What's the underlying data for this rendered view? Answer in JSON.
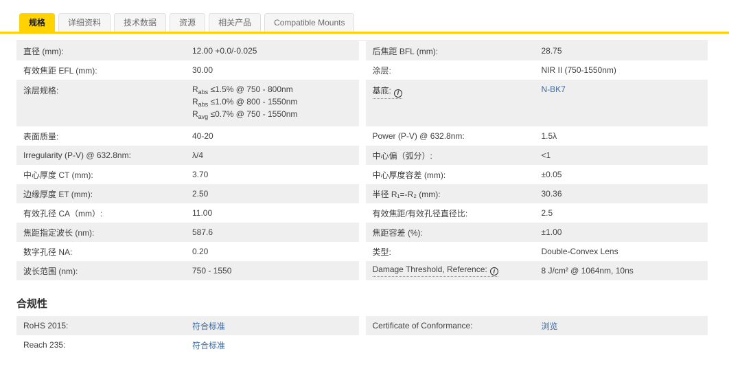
{
  "tabs": {
    "items": [
      {
        "label": "规格",
        "active": true
      },
      {
        "label": "详细资料",
        "active": false
      },
      {
        "label": "技术数据",
        "active": false
      },
      {
        "label": "资源",
        "active": false
      },
      {
        "label": "相关产品",
        "active": false
      },
      {
        "label": "Compatible Mounts",
        "active": false
      }
    ]
  },
  "colors": {
    "accent_yellow": "#FFD200",
    "link_blue": "#3A68A0",
    "row_stripe": "#EFEFEF",
    "text": "#3F3F3E"
  },
  "spec_table": {
    "rows": [
      {
        "left": {
          "label": "直径 (mm):",
          "value": "12.00 +0.0/-0.025"
        },
        "right": {
          "label": "后焦距 BFL (mm):",
          "value": "28.75"
        }
      },
      {
        "left": {
          "label": "有效焦距 EFL (mm):",
          "value": "30.00"
        },
        "right": {
          "label": "涂层:",
          "value": "NIR II (750-1550nm)"
        }
      },
      {
        "left": {
          "label": "涂层规格:",
          "value_lines": [
            {
              "base": "R",
              "sub": "abs",
              "rest": " ≤1.5% @ 750 - 800nm"
            },
            {
              "base": "R",
              "sub": "abs",
              "rest": " ≤1.0% @ 800 - 1550nm"
            },
            {
              "base": "R",
              "sub": "avg",
              "rest": " ≤0.7% @ 750 - 1550nm"
            }
          ]
        },
        "right": {
          "label": "基底:",
          "has_info": true,
          "value": "N-BK7",
          "is_link": true
        }
      },
      {
        "left": {
          "label": "表面质量:",
          "value": "40-20"
        },
        "right": {
          "label": "Power (P-V) @ 632.8nm:",
          "value": "1.5λ"
        }
      },
      {
        "left": {
          "label": "Irregularity (P-V) @ 632.8nm:",
          "value": "λ/4"
        },
        "right": {
          "label": "中心偏（弧分）:",
          "value": "<1"
        }
      },
      {
        "left": {
          "label": "中心厚度 CT (mm):",
          "value": "3.70"
        },
        "right": {
          "label": "中心厚度容差 (mm):",
          "value": "±0.05"
        }
      },
      {
        "left": {
          "label": "边缘厚度 ET (mm):",
          "value": "2.50"
        },
        "right": {
          "label": "半径 R₁=-R₂ (mm):",
          "value": "30.36"
        }
      },
      {
        "left": {
          "label": "有效孔径 CA（mm）:",
          "value": "11.00"
        },
        "right": {
          "label": "有效焦距/有效孔径直径比:",
          "value": "2.5"
        }
      },
      {
        "left": {
          "label": "焦距指定波长 (nm):",
          "value": "587.6"
        },
        "right": {
          "label": "焦距容差 (%):",
          "value": "±1.00"
        }
      },
      {
        "left": {
          "label": "数字孔径 NA:",
          "value": "0.20"
        },
        "right": {
          "label": "类型:",
          "value": "Double-Convex Lens"
        }
      },
      {
        "left": {
          "label": "波长范围 (nm):",
          "value": "750 - 1550"
        },
        "right": {
          "label": "Damage Threshold, Reference:",
          "has_info": true,
          "value": "8 J/cm² @ 1064nm, 10ns"
        }
      }
    ]
  },
  "compliance": {
    "heading": "合规性",
    "rows": [
      {
        "left": {
          "label": "RoHS 2015:",
          "value": "符合标准",
          "is_link": true
        },
        "right": {
          "label": "Certificate of Conformance:",
          "value": "浏览",
          "is_link": true
        }
      },
      {
        "left": {
          "label": "Reach 235:",
          "value": "符合标准",
          "is_link": true
        },
        "right": {
          "label": "",
          "value": ""
        }
      }
    ]
  }
}
